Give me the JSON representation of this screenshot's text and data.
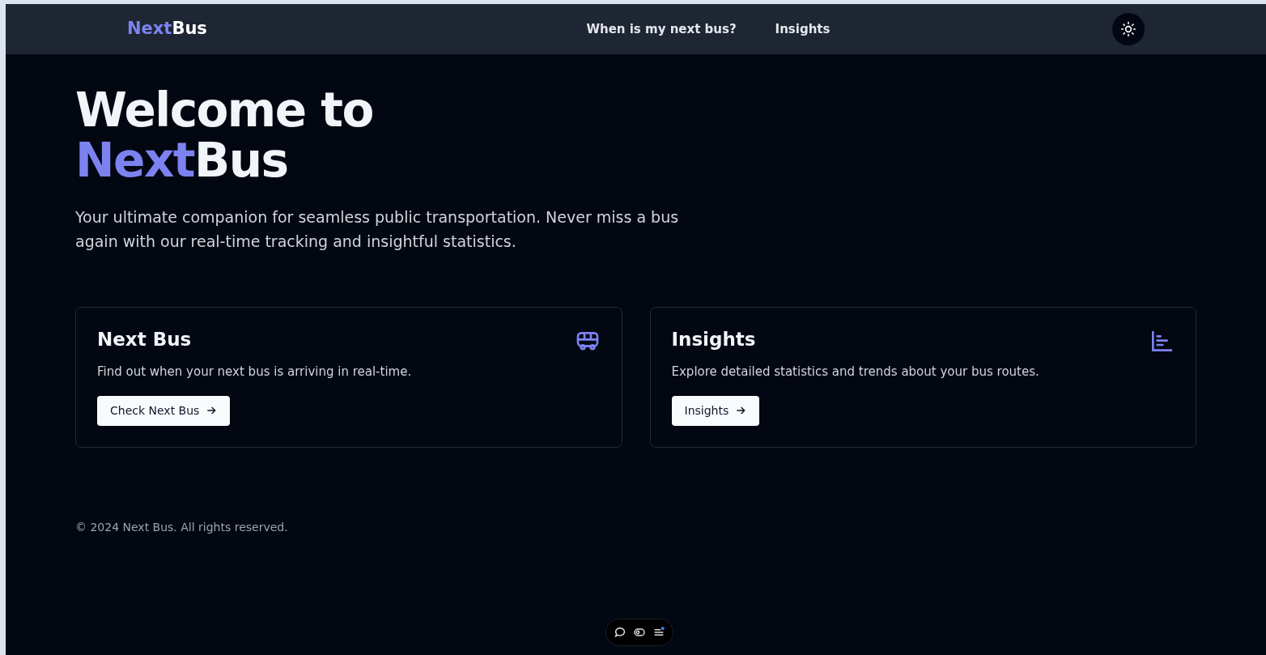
{
  "navbar": {
    "brand": {
      "accent": "Next",
      "rest": "Bus"
    },
    "links": [
      {
        "label": "When is my next bus?"
      },
      {
        "label": "Insights"
      }
    ]
  },
  "hero": {
    "title_line_1": "Welcome to",
    "title_accent": "Next",
    "title_rest": "Bus",
    "subtitle": "Your ultimate companion for seamless public transportation. Never miss a bus again with our real-time tracking and insightful statistics."
  },
  "cards": [
    {
      "kind": "bus",
      "title": "Next Bus",
      "text": "Find out when your next bus is arriving in real-time.",
      "button": "Check Next Bus"
    },
    {
      "kind": "chart",
      "title": "Insights",
      "text": "Explore detailed statistics and trends about your bus routes.",
      "button": "Insights"
    }
  ],
  "footer": {
    "text": "© 2024 Next Bus. All rights reserved."
  }
}
